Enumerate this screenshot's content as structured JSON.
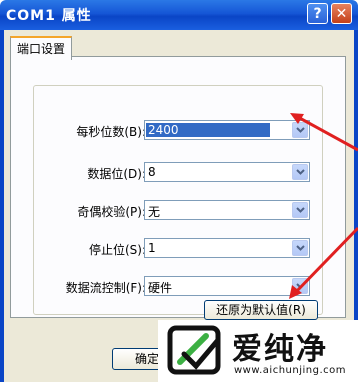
{
  "window": {
    "title": "COM1 属性",
    "help_label": "?",
    "close_label": "✕"
  },
  "tabs": [
    {
      "label": "端口设置"
    }
  ],
  "settings": [
    {
      "label": "每秒位数(B):",
      "value": "2400",
      "selected": true
    },
    {
      "label": "数据位(D):",
      "value": "8"
    },
    {
      "label": "奇偶校验(P):",
      "value": "无"
    },
    {
      "label": "停止位(S):",
      "value": "1"
    },
    {
      "label": "数据流控制(F):",
      "value": "硬件"
    }
  ],
  "buttons": {
    "restore_defaults": "还原为默认值(R)",
    "ok": "确定"
  },
  "watermark": {
    "brand": "爱纯净",
    "url": "www.aichunjing.com"
  },
  "colors": {
    "title_bar": "#0a45c6",
    "dialog_bg": "#ece9d8",
    "selection": "#316ac5",
    "annotation_arrow": "#e02020"
  }
}
